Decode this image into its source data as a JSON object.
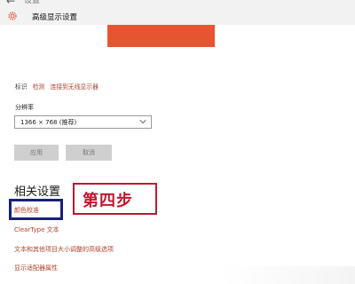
{
  "header": {
    "back_glyph": "←",
    "top_label": "设置",
    "icon": "gear-icon",
    "title": "高级显示设置"
  },
  "display": {
    "monitor_color": "#e65531"
  },
  "links": {
    "identify": "标识",
    "detect": "检测",
    "wireless": "连接到无线显示器"
  },
  "resolution": {
    "label": "分辨率",
    "value": "1366 × 768 (推荐)"
  },
  "buttons": {
    "apply": "应用",
    "cancel": "取消"
  },
  "related": {
    "heading": "相关设置",
    "items": [
      "颜色校准",
      "ClearType 文本",
      "文本和其他项目大小调整的高级选项",
      "显示适配器属性"
    ]
  },
  "annotation": {
    "text": "第四步",
    "red_color": "#c0182f",
    "blue_color": "#17207e"
  },
  "colors": {
    "accent": "#e65531",
    "link": "#b0422a"
  }
}
